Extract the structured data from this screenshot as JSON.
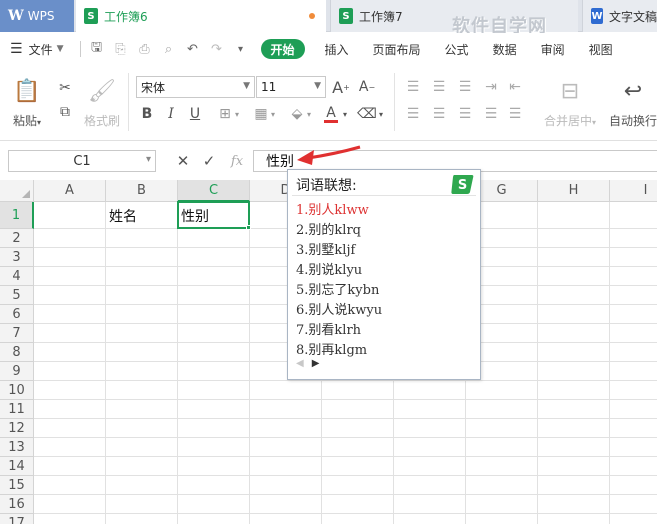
{
  "tabs": {
    "wps_label": "WPS",
    "active_label": "工作簿6",
    "third_label": "工作簿7",
    "fourth_label": "文字文稿"
  },
  "watermark": "软件自学网",
  "menu": {
    "file": "文件",
    "start": "开始",
    "insert": "插入",
    "layout": "页面布局",
    "formula": "公式",
    "data": "数据",
    "review": "审阅",
    "view": "视图"
  },
  "ribbon": {
    "paste": "粘贴",
    "format_painter": "格式刷",
    "font_name": "宋体",
    "font_size": "11",
    "bold": "B",
    "italic": "I",
    "underline": "U",
    "font_color_glyph": "A",
    "merge_center": "合并居中",
    "auto_wrap": "自动换行"
  },
  "formula_bar": {
    "name_box": "C1",
    "fx": "fx",
    "content": "性别"
  },
  "columns": [
    "A",
    "B",
    "C",
    "D",
    "E",
    "F",
    "G",
    "H",
    "I"
  ],
  "rows": [
    "1",
    "2",
    "3",
    "4",
    "5",
    "6",
    "7",
    "8",
    "9",
    "10",
    "11",
    "12",
    "13",
    "14",
    "15",
    "16",
    "17"
  ],
  "cells": {
    "B1": "姓名",
    "C1": "性别"
  },
  "ime": {
    "title": "词语联想:",
    "candidates": [
      "1.别人klww",
      "2.别的klrq",
      "3.别墅kljf",
      "4.别说klyu",
      "5.别忘了kybn",
      "6.别人说kwyu",
      "7.别看klrh",
      "8.别再klgm"
    ]
  },
  "colors": {
    "accent": "#1e9e56",
    "wps_tab": "#6a8fc9",
    "annotation_arrow": "#e03030",
    "first_candidate": "#dd3333"
  }
}
